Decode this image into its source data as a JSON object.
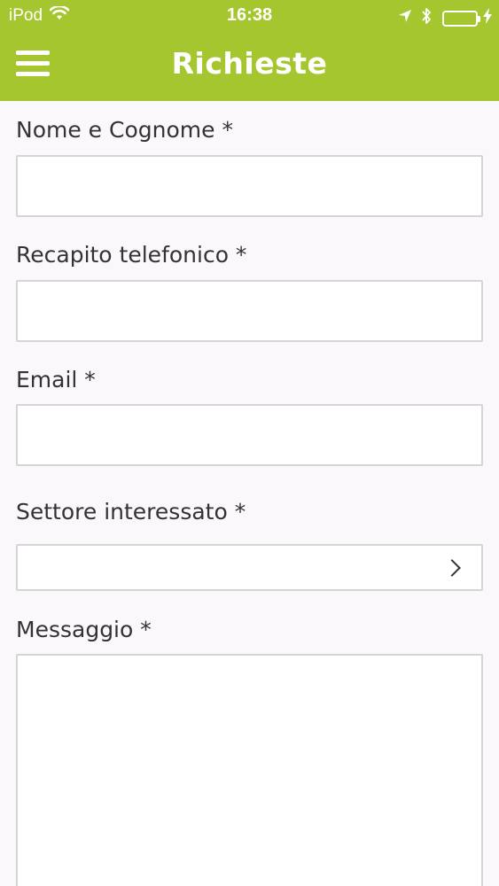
{
  "status": {
    "carrier": "iPod",
    "time": "16:38"
  },
  "navbar": {
    "title": "Richieste"
  },
  "form": {
    "fields": [
      {
        "label": "Nome e Cognome *",
        "value": ""
      },
      {
        "label": "Recapito telefonico *",
        "value": ""
      },
      {
        "label": "Email *",
        "value": ""
      },
      {
        "label": "Settore interessato *",
        "value": ""
      },
      {
        "label": "Messaggio *",
        "value": ""
      }
    ]
  },
  "colors": {
    "brand": "#a6c62f",
    "background": "#fbf8fb",
    "border": "#d6d4d6"
  }
}
